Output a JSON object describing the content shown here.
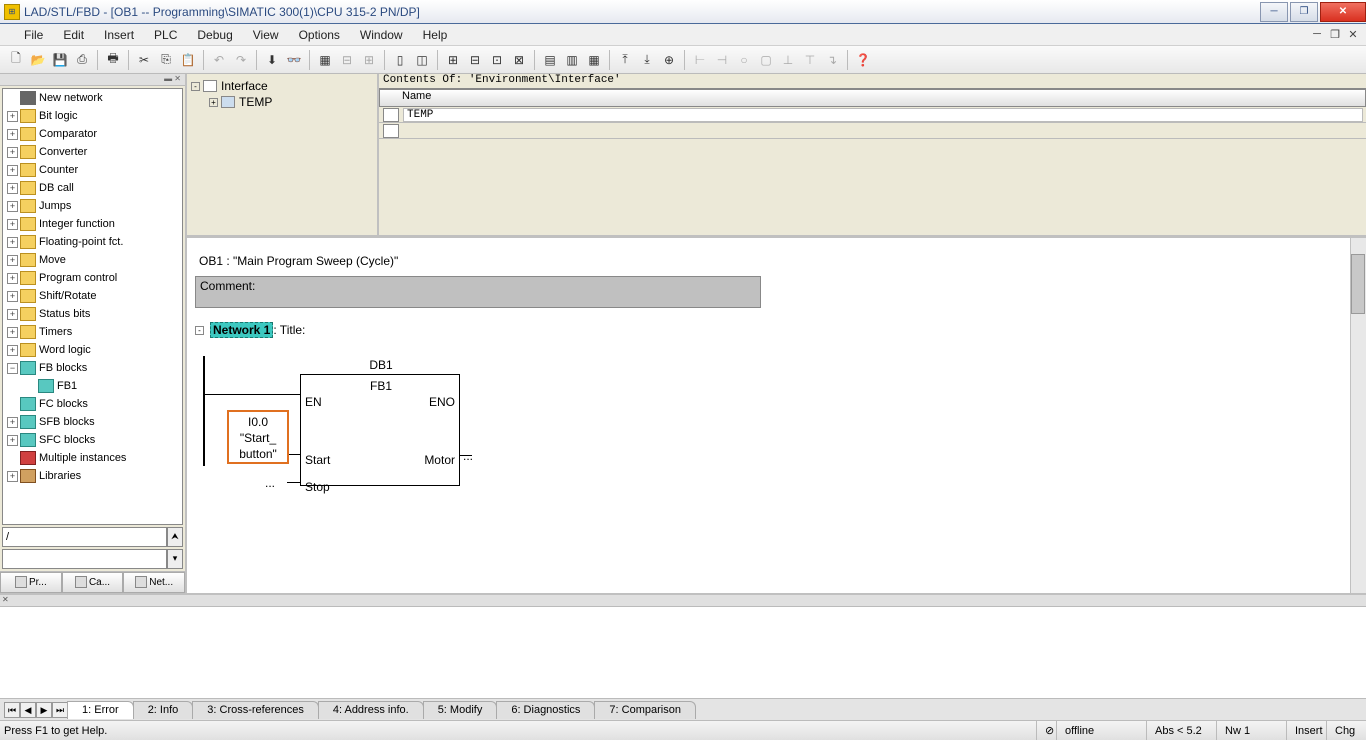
{
  "title": "LAD/STL/FBD  - [OB1 -- Programming\\SIMATIC 300(1)\\CPU 315-2 PN/DP]",
  "menu": [
    "File",
    "Edit",
    "Insert",
    "PLC",
    "Debug",
    "View",
    "Options",
    "Window",
    "Help"
  ],
  "tree": [
    {
      "icon": "new",
      "label": "New network",
      "indent": 0,
      "exp": ""
    },
    {
      "icon": "yellow",
      "label": "Bit logic",
      "indent": 0,
      "exp": "+"
    },
    {
      "icon": "yellow",
      "label": "Comparator",
      "indent": 0,
      "exp": "+"
    },
    {
      "icon": "yellow",
      "label": "Converter",
      "indent": 0,
      "exp": "+"
    },
    {
      "icon": "yellow",
      "label": "Counter",
      "indent": 0,
      "exp": "+"
    },
    {
      "icon": "yellow",
      "label": "DB call",
      "indent": 0,
      "exp": "+"
    },
    {
      "icon": "yellow",
      "label": "Jumps",
      "indent": 0,
      "exp": "+"
    },
    {
      "icon": "yellow",
      "label": "Integer function",
      "indent": 0,
      "exp": "+"
    },
    {
      "icon": "yellow",
      "label": "Floating-point fct.",
      "indent": 0,
      "exp": "+"
    },
    {
      "icon": "yellow",
      "label": "Move",
      "indent": 0,
      "exp": "+"
    },
    {
      "icon": "yellow",
      "label": "Program control",
      "indent": 0,
      "exp": "+"
    },
    {
      "icon": "yellow",
      "label": "Shift/Rotate",
      "indent": 0,
      "exp": "+"
    },
    {
      "icon": "yellow",
      "label": "Status bits",
      "indent": 0,
      "exp": "+"
    },
    {
      "icon": "yellow",
      "label": "Timers",
      "indent": 0,
      "exp": "+"
    },
    {
      "icon": "yellow",
      "label": "Word logic",
      "indent": 0,
      "exp": "+"
    },
    {
      "icon": "teal",
      "label": "FB blocks",
      "indent": 0,
      "exp": "−"
    },
    {
      "icon": "teal",
      "label": "FB1",
      "indent": 1,
      "exp": "",
      "sel": true
    },
    {
      "icon": "teal",
      "label": "FC blocks",
      "indent": 0,
      "exp": ""
    },
    {
      "icon": "teal",
      "label": "SFB blocks",
      "indent": 0,
      "exp": "+"
    },
    {
      "icon": "teal",
      "label": "SFC blocks",
      "indent": 0,
      "exp": "+"
    },
    {
      "icon": "red",
      "label": "Multiple instances",
      "indent": 0,
      "exp": ""
    },
    {
      "icon": "book",
      "label": "Libraries",
      "indent": 0,
      "exp": "+"
    }
  ],
  "sidebar_tabs": [
    "Pr...",
    "Ca...",
    "Net..."
  ],
  "interface": {
    "root": "Interface",
    "temp": "TEMP"
  },
  "env": {
    "header": "Contents Of: 'Environment\\Interface'",
    "col": "Name",
    "row": "TEMP"
  },
  "editor": {
    "ob": "OB1 :  \"Main Program Sweep (Cycle)\"",
    "comment_label": "Comment:",
    "network": "Network 1",
    "network_suffix": ": Title:",
    "db": "DB1",
    "fb": "FB1",
    "en": "EN",
    "eno": "ENO",
    "start": "Start",
    "stop": "Stop",
    "motor": "Motor",
    "io": "I0.0",
    "sym": "\"Start_\nbutton\"",
    "dots": "..."
  },
  "output_tabs": [
    "1: Error",
    "2: Info",
    "3: Cross-references",
    "4: Address info.",
    "5: Modify",
    "6: Diagnostics",
    "7: Comparison"
  ],
  "status": {
    "msg": "Press F1 to get Help.",
    "offline": "offline",
    "abs": "Abs < 5.2",
    "nw": "Nw 1",
    "insert": "Insert",
    "chg": "Chg"
  }
}
